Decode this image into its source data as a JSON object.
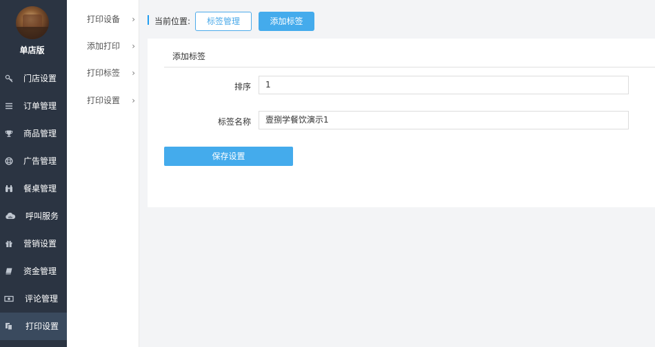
{
  "brand": {
    "name": "单店版"
  },
  "sidebar": {
    "items": [
      {
        "label": "门店设置",
        "icon": "key-icon"
      },
      {
        "label": "订单管理",
        "icon": "list-icon"
      },
      {
        "label": "商品管理",
        "icon": "trophy-icon"
      },
      {
        "label": "广告管理",
        "icon": "lifebuoy-icon"
      },
      {
        "label": "餐桌管理",
        "icon": "binoculars-icon"
      },
      {
        "label": "呼叫服务",
        "icon": "cloud-icon"
      },
      {
        "label": "营销设置",
        "icon": "gift-icon"
      },
      {
        "label": "资金管理",
        "icon": "book-icon"
      },
      {
        "label": "评论管理",
        "icon": "money-icon"
      },
      {
        "label": "打印设置",
        "icon": "copy-icon",
        "active": true
      }
    ]
  },
  "subnav": {
    "items": [
      {
        "label": "打印设备"
      },
      {
        "label": "添加打印"
      },
      {
        "label": "打印标签"
      },
      {
        "label": "打印设置"
      }
    ]
  },
  "breadcrumb": {
    "label": "当前位置:",
    "buttons": [
      {
        "label": "标签管理"
      },
      {
        "label": "添加标签"
      }
    ]
  },
  "form": {
    "title": "添加标签",
    "fields": {
      "sort": {
        "label": "排序",
        "value": "1"
      },
      "name": {
        "label": "标签名称",
        "value": "壹捌学餐饮演示1"
      }
    },
    "save_label": "保存设置"
  },
  "colors": {
    "sidebar_bg": "#2b3442",
    "accent": "#44abec"
  }
}
